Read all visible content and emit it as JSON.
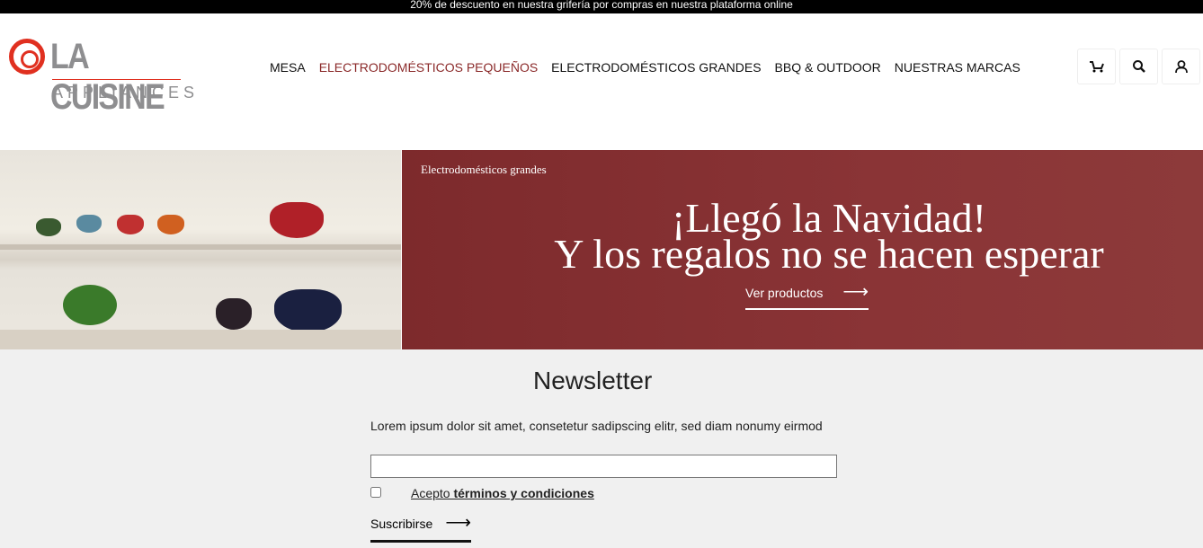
{
  "promo": "20% de descuento en nuestra grifería por compras en nuestra plataforma online",
  "logo": {
    "name": "LA CUISINE",
    "sub": "APPLIANCES"
  },
  "nav": [
    "MESA",
    "ELECTRODOMÉSTICOS PEQUEÑOS",
    "ELECTRODOMÉSTICOS GRANDES",
    "BBQ & OUTDOOR",
    "NUESTRAS MARCAS"
  ],
  "hero": {
    "category": "Electrodomésticos grandes",
    "title1": "¡Llegó la Navidad!",
    "title2": "Y los regalos no se hacen esperar",
    "cta": "Ver productos"
  },
  "newsletter": {
    "title": "Newsletter",
    "desc": "Lorem ipsum dolor sit amet, consetetur sadipscing elitr, sed diam nonumy eirmod",
    "email_value": "",
    "terms_prefix": "Acepto ",
    "terms_bold": "términos y condiciones",
    "subscribe": "Suscribirse"
  },
  "colors": {
    "accent": "#8b2a2a",
    "hero": "#842f31",
    "logo_red": "#e03020"
  }
}
